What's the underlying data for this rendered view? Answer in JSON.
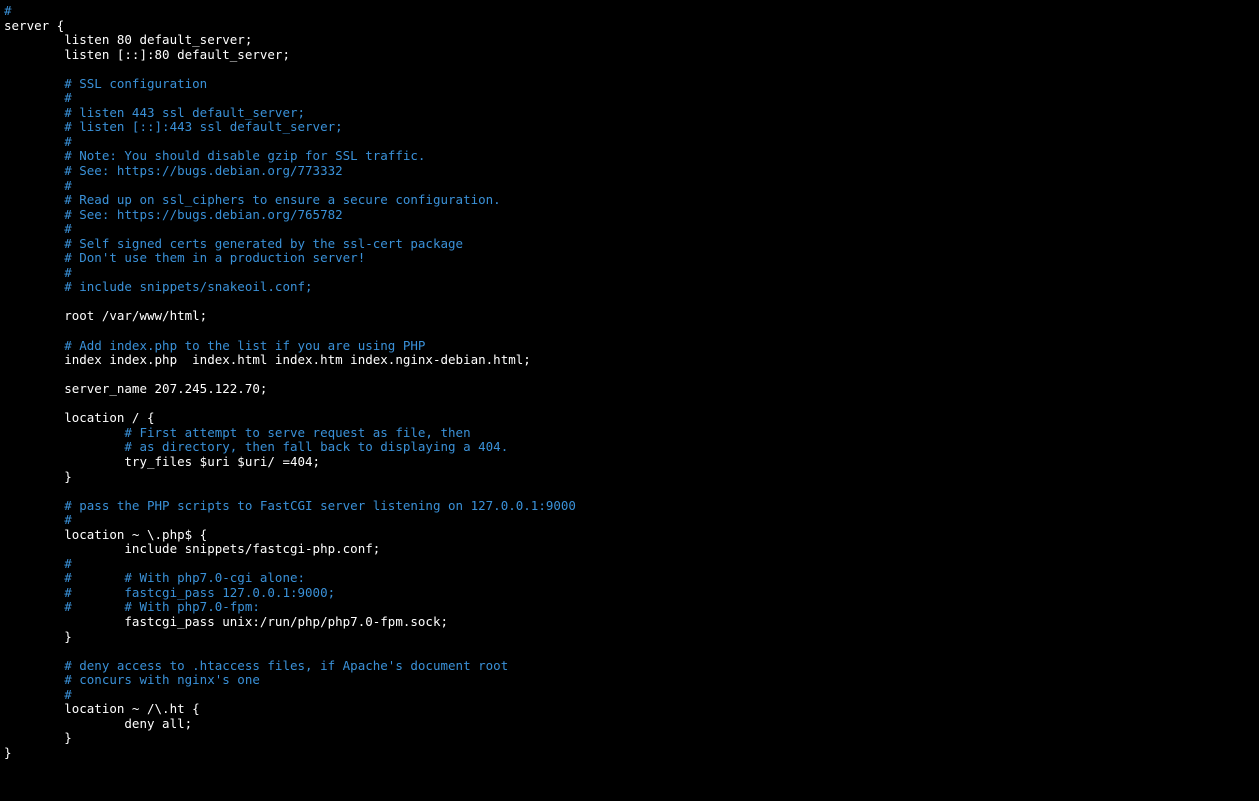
{
  "lines": [
    {
      "indent": 0,
      "text": "#",
      "type": "comment"
    },
    {
      "indent": 0,
      "text": "server {",
      "type": "code"
    },
    {
      "indent": 1,
      "text": "listen 80 default_server;",
      "type": "code"
    },
    {
      "indent": 1,
      "text": "listen [::]:80 default_server;",
      "type": "code"
    },
    {
      "indent": 0,
      "text": "",
      "type": "blank"
    },
    {
      "indent": 1,
      "text": "# SSL configuration",
      "type": "comment"
    },
    {
      "indent": 1,
      "text": "#",
      "type": "comment"
    },
    {
      "indent": 1,
      "text": "# listen 443 ssl default_server;",
      "type": "comment"
    },
    {
      "indent": 1,
      "text": "# listen [::]:443 ssl default_server;",
      "type": "comment"
    },
    {
      "indent": 1,
      "text": "#",
      "type": "comment"
    },
    {
      "indent": 1,
      "text": "# Note: You should disable gzip for SSL traffic.",
      "type": "comment"
    },
    {
      "indent": 1,
      "text": "# See: https://bugs.debian.org/773332",
      "type": "comment"
    },
    {
      "indent": 1,
      "text": "#",
      "type": "comment"
    },
    {
      "indent": 1,
      "text": "# Read up on ssl_ciphers to ensure a secure configuration.",
      "type": "comment"
    },
    {
      "indent": 1,
      "text": "# See: https://bugs.debian.org/765782",
      "type": "comment"
    },
    {
      "indent": 1,
      "text": "#",
      "type": "comment"
    },
    {
      "indent": 1,
      "text": "# Self signed certs generated by the ssl-cert package",
      "type": "comment"
    },
    {
      "indent": 1,
      "text": "# Don't use them in a production server!",
      "type": "comment"
    },
    {
      "indent": 1,
      "text": "#",
      "type": "comment"
    },
    {
      "indent": 1,
      "text": "# include snippets/snakeoil.conf;",
      "type": "comment"
    },
    {
      "indent": 0,
      "text": "",
      "type": "blank"
    },
    {
      "indent": 1,
      "text": "root /var/www/html;",
      "type": "code"
    },
    {
      "indent": 0,
      "text": "",
      "type": "blank"
    },
    {
      "indent": 1,
      "text": "# Add index.php to the list if you are using PHP",
      "type": "comment"
    },
    {
      "indent": 1,
      "text": "index index.php  index.html index.htm index.nginx-debian.html;",
      "type": "code"
    },
    {
      "indent": 0,
      "text": "",
      "type": "blank"
    },
    {
      "indent": 1,
      "text": "server_name 207.245.122.70;",
      "type": "code"
    },
    {
      "indent": 0,
      "text": "",
      "type": "blank"
    },
    {
      "indent": 1,
      "text": "location / {",
      "type": "code"
    },
    {
      "indent": 2,
      "text": "# First attempt to serve request as file, then",
      "type": "comment"
    },
    {
      "indent": 2,
      "text": "# as directory, then fall back to displaying a 404.",
      "type": "comment"
    },
    {
      "indent": 2,
      "text": "try_files $uri $uri/ =404;",
      "type": "code"
    },
    {
      "indent": 1,
      "text": "}",
      "type": "code"
    },
    {
      "indent": 0,
      "text": "",
      "type": "blank"
    },
    {
      "indent": 1,
      "text": "# pass the PHP scripts to FastCGI server listening on 127.0.0.1:9000",
      "type": "comment"
    },
    {
      "indent": 1,
      "text": "#",
      "type": "comment"
    },
    {
      "indent": 1,
      "text": "location ~ \\.php$ {",
      "type": "code"
    },
    {
      "indent": 2,
      "text": "include snippets/fastcgi-php.conf;",
      "type": "code"
    },
    {
      "indent": 1,
      "text": "#",
      "type": "comment"
    },
    {
      "indent": 1,
      "text": "#       # With php7.0-cgi alone:",
      "type": "comment"
    },
    {
      "indent": 1,
      "text": "#       fastcgi_pass 127.0.0.1:9000;",
      "type": "comment"
    },
    {
      "indent": 1,
      "text": "#       # With php7.0-fpm:",
      "type": "comment"
    },
    {
      "indent": 2,
      "text": "fastcgi_pass unix:/run/php/php7.0-fpm.sock;",
      "type": "code"
    },
    {
      "indent": 1,
      "text": "}",
      "type": "code"
    },
    {
      "indent": 0,
      "text": "",
      "type": "blank"
    },
    {
      "indent": 1,
      "text": "# deny access to .htaccess files, if Apache's document root",
      "type": "comment"
    },
    {
      "indent": 1,
      "text": "# concurs with nginx's one",
      "type": "comment"
    },
    {
      "indent": 1,
      "text": "#",
      "type": "comment"
    },
    {
      "indent": 1,
      "text": "location ~ /\\.ht {",
      "type": "code"
    },
    {
      "indent": 2,
      "text": "deny all;",
      "type": "code"
    },
    {
      "indent": 1,
      "text": "}",
      "type": "code"
    },
    {
      "indent": 0,
      "text": "}",
      "type": "code"
    }
  ],
  "indent_unit": "        "
}
